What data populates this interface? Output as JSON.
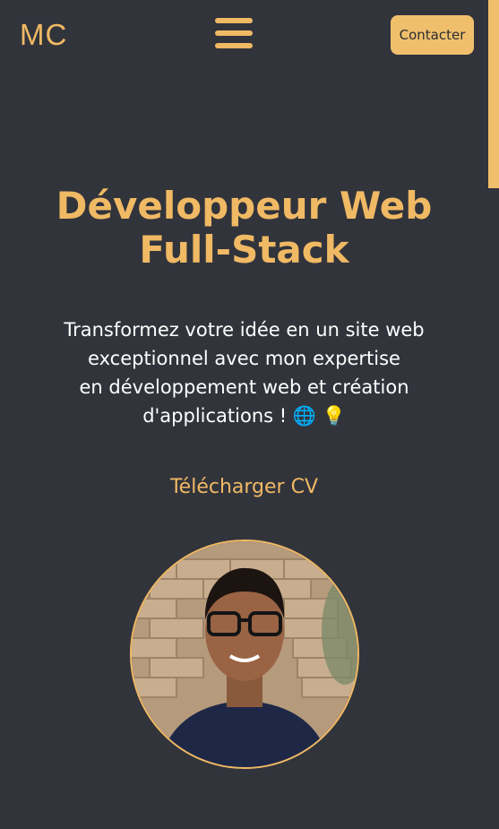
{
  "header": {
    "logo": "MC",
    "menu_icon": "hamburger-menu-icon",
    "contact_label": "Contacter"
  },
  "hero": {
    "title_line1": "Développeur Web",
    "title_line2": "Full-Stack",
    "subtitle_line1": "Transformez votre idée en un site web",
    "subtitle_line2": "exceptionnel avec mon expertise",
    "subtitle_line3": "en développement web et création",
    "subtitle_line4": "d'applications ! 🌐 💡",
    "cv_label": "Télécharger CV",
    "avatar_icon": "profile-photo"
  },
  "colors": {
    "background": "#32343c",
    "accent": "#f0b964",
    "button": "#f0bf6c",
    "text": "#ffffff"
  }
}
